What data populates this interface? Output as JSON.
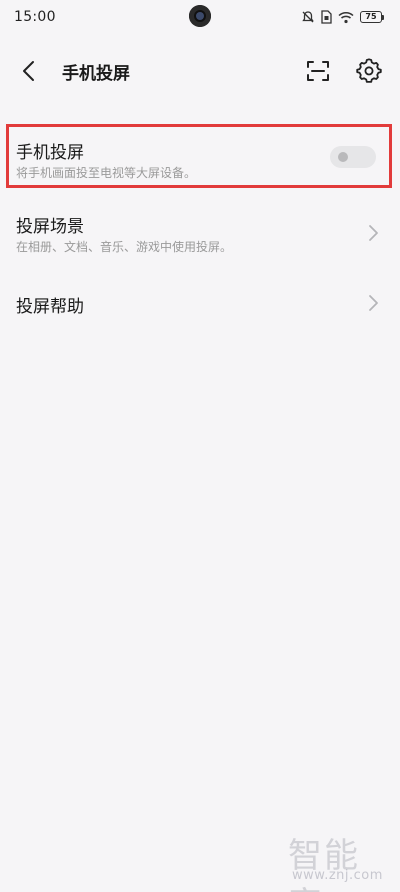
{
  "status_bar": {
    "time": "15:00",
    "battery": "75",
    "icons": [
      "mute-icon",
      "sim-icon",
      "wifi-icon",
      "battery-icon"
    ]
  },
  "header": {
    "title": "手机投屏",
    "back_icon": "chevron-left-icon",
    "scan_icon": "scan-icon",
    "settings_icon": "gear-icon"
  },
  "settings": {
    "screen_mirroring": {
      "title": "手机投屏",
      "subtitle": "将手机画面投至电视等大屏设备。",
      "toggle_on": false
    },
    "cast_scenes": {
      "title": "投屏场景",
      "subtitle": "在相册、文档、音乐、游戏中使用投屏。"
    },
    "cast_help": {
      "title": "投屏帮助"
    }
  },
  "watermark": {
    "brand": "智能家",
    "url": "www.znj.com"
  },
  "colors": {
    "background": "#f6f5f7",
    "highlight": "#e23b3b",
    "toggle_off": "#e6e6e8"
  }
}
